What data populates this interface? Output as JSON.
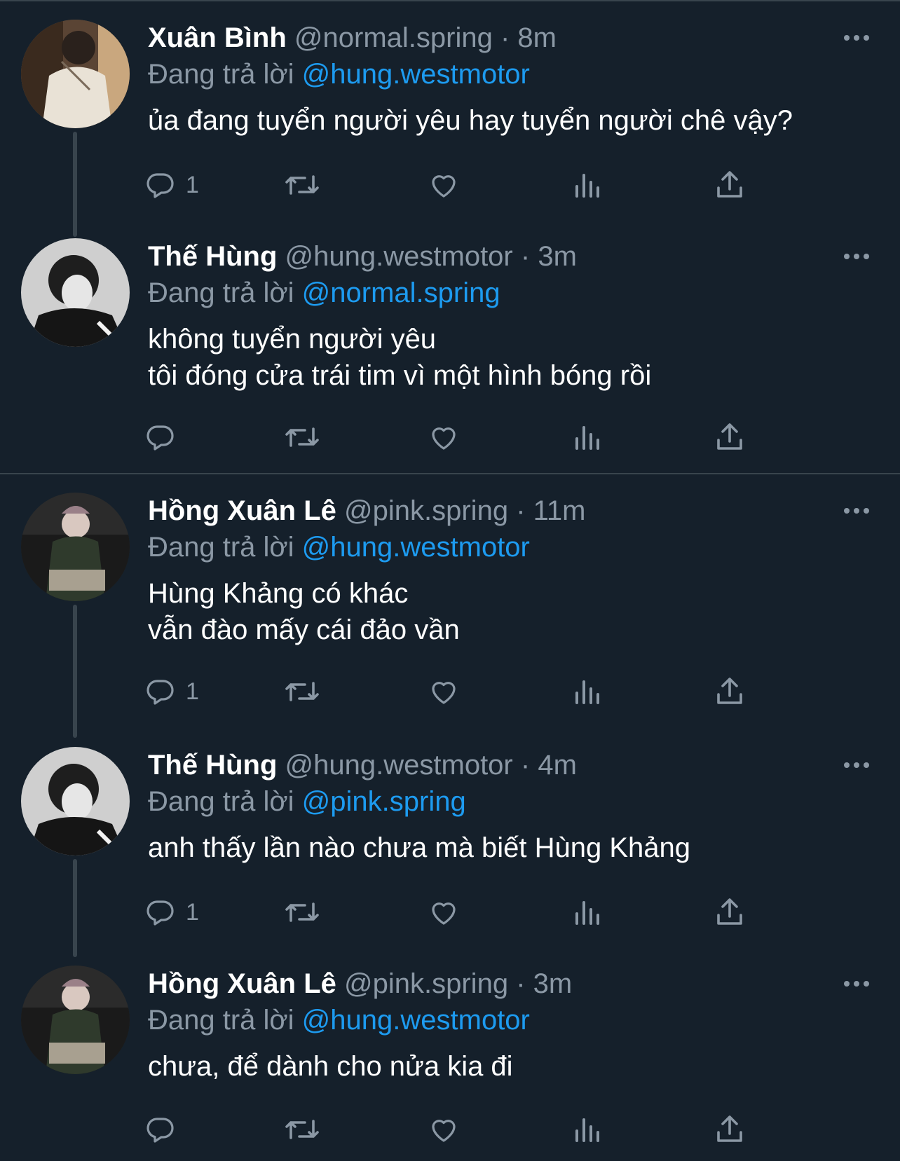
{
  "replying_label": "Đang trả lời",
  "tweets": [
    {
      "name": "Xuân Bình",
      "handle": "@normal.spring",
      "separator": "·",
      "time": "8m",
      "reply_to": "@hung.westmotor",
      "lines": [
        "ủa đang tuyển người yêu hay tuyển người chê vậy?"
      ],
      "reply_count": "1",
      "avatar_icon": "person-photo-icon"
    },
    {
      "name": "Thế Hùng",
      "handle": "@hung.westmotor",
      "separator": "·",
      "time": "3m",
      "reply_to": "@normal.spring",
      "lines": [
        "không tuyển người yêu",
        "tôi đóng cửa trái tim vì một hình bóng rồi"
      ],
      "reply_count": "",
      "avatar_icon": "person-photo-icon"
    },
    {
      "name": "Hồng Xuân Lê",
      "handle": "@pink.spring",
      "separator": "·",
      "time": "11m",
      "reply_to": "@hung.westmotor",
      "lines": [
        "Hùng Khảng có khác",
        "vẫn đào mấy cái đảo vần"
      ],
      "reply_count": "1",
      "avatar_icon": "person-photo-icon"
    },
    {
      "name": "Thế Hùng",
      "handle": "@hung.westmotor",
      "separator": "·",
      "time": "4m",
      "reply_to": "@pink.spring",
      "lines": [
        "anh thấy lần nào chưa mà biết Hùng Khảng"
      ],
      "reply_count": "1",
      "avatar_icon": "person-photo-icon"
    },
    {
      "name": "Hồng Xuân Lê",
      "handle": "@pink.spring",
      "separator": "·",
      "time": "3m",
      "reply_to": "@hung.westmotor",
      "lines": [
        "chưa, để dành cho nửa kia đi"
      ],
      "reply_count": "",
      "avatar_icon": "person-photo-icon"
    }
  ],
  "icons": {
    "reply": "reply-icon",
    "retweet": "retweet-icon",
    "like": "heart-icon",
    "views": "analytics-icon",
    "share": "share-icon",
    "more": "more-icon"
  },
  "colors": {
    "background": "#15202b",
    "text": "#ffffff",
    "muted": "#8b98a5",
    "link": "#1d9bf0",
    "divider": "#38444d"
  }
}
